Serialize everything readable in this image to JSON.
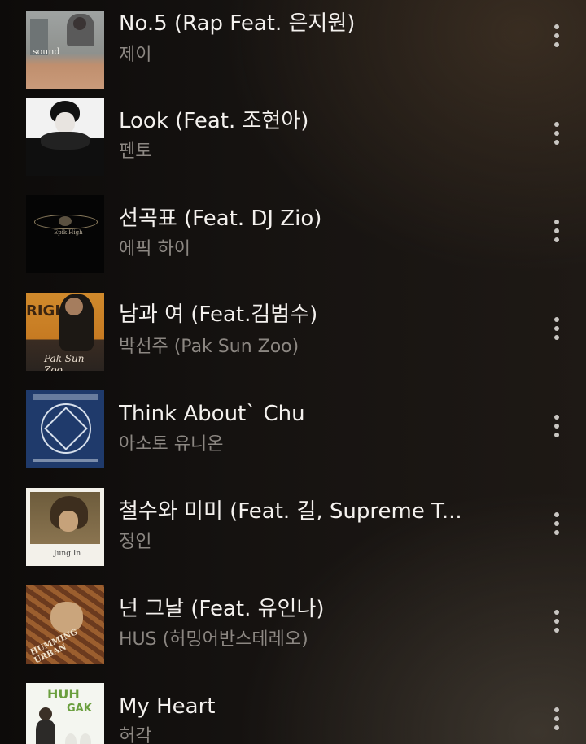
{
  "songs": [
    {
      "title": "No.5 (Rap Feat. 은지원)",
      "artist": "제이",
      "art": "jay-cover"
    },
    {
      "title": "Look (Feat. 조현아)",
      "artist": "펜토",
      "art": "pento-cover"
    },
    {
      "title": "선곡표 (Feat. DJ Zio)",
      "artist": "에픽 하이",
      "art": "epik-high-cover"
    },
    {
      "title": "남과 여 (Feat.김범수)",
      "artist": "박선주 (Pak Sun Zoo)",
      "art": "pak-sun-zoo-cover"
    },
    {
      "title": "Think About` Chu",
      "artist": "아소토 유니온",
      "art": "asoto-union-cover"
    },
    {
      "title": "철수와 미미 (Feat. 길, Supreme T...",
      "artist": "정인",
      "art": "jungin-cover"
    },
    {
      "title": "넌 그날 (Feat. 유인나)",
      "artist": "HUS (허밍어반스테레오)",
      "art": "hus-cover"
    },
    {
      "title": "My Heart",
      "artist": "허각",
      "art": "huh-gak-cover"
    }
  ],
  "colors": {
    "title": "#f4f1ee",
    "artist": "#8c8782",
    "more_icon": "#c9c6c2"
  },
  "icons": {
    "more": "more-vertical-icon"
  }
}
